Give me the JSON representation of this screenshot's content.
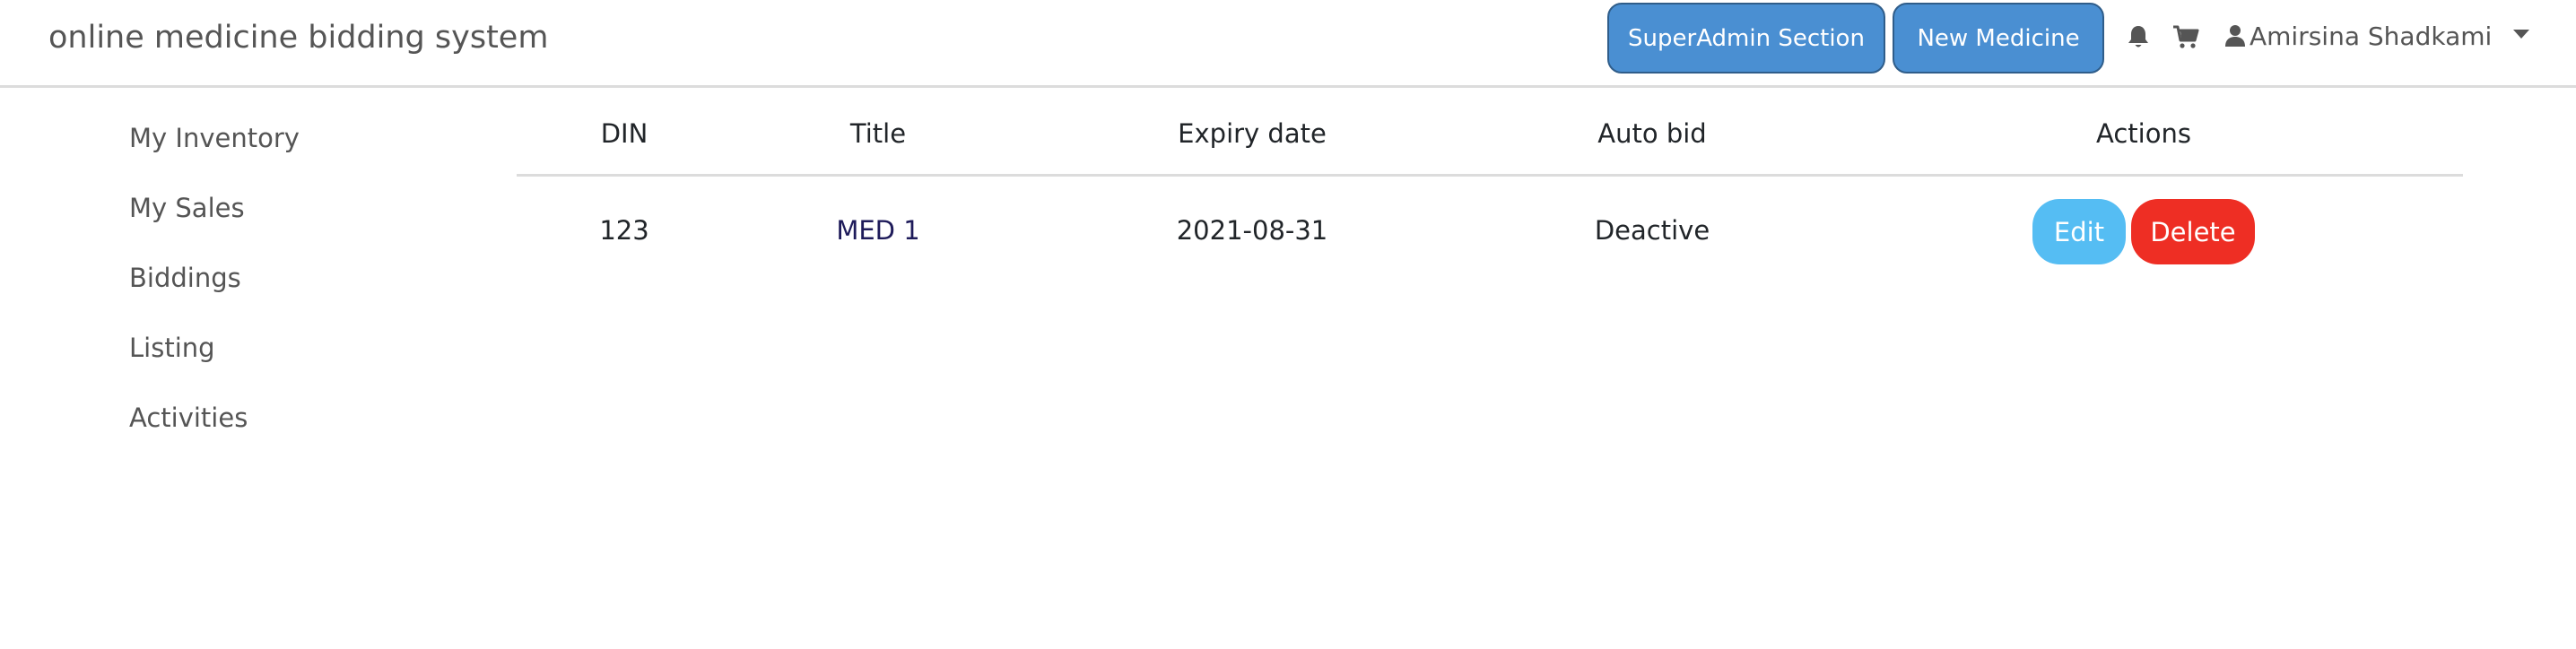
{
  "header": {
    "brand": "online medicine bidding system",
    "superadmin_label": "SuperAdmin Section",
    "new_medicine_label": "New Medicine",
    "user_name": "Amirsina Shadkami"
  },
  "icons": {
    "bell": "bell-icon",
    "cart": "cart-icon",
    "user": "user-icon",
    "caret": "caret-down-icon"
  },
  "sidebar": {
    "items": [
      {
        "label": "My Inventory"
      },
      {
        "label": "My Sales"
      },
      {
        "label": "Biddings"
      },
      {
        "label": "Listing"
      },
      {
        "label": "Activities"
      }
    ]
  },
  "table": {
    "columns": [
      "DIN",
      "Title",
      "Expiry date",
      "Auto bid",
      "Actions"
    ],
    "rows": [
      {
        "din": "123",
        "title": "MED 1",
        "expiry": "2021-08-31",
        "auto_bid": "Deactive",
        "edit_label": "Edit",
        "delete_label": "Delete"
      }
    ]
  },
  "colors": {
    "primary": "#4a8fd2",
    "info": "#55bdf3",
    "danger": "#ee2e24",
    "muted_text": "#555555"
  }
}
